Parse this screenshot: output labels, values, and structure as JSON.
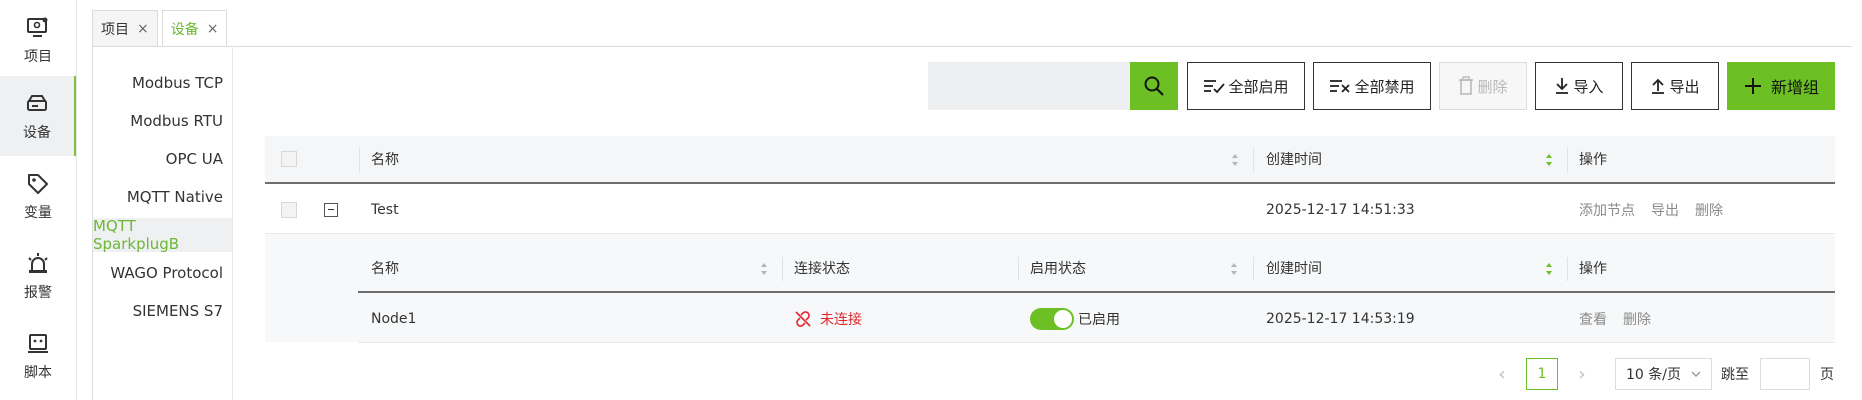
{
  "rail": [
    {
      "label": "项目",
      "icon": "monitor-settings-icon"
    },
    {
      "label": "设备",
      "icon": "router-icon",
      "active": true
    },
    {
      "label": "变量",
      "icon": "tag-icon"
    },
    {
      "label": "报警",
      "icon": "alarm-light-icon"
    },
    {
      "label": "脚本",
      "icon": "script-terminal-icon"
    }
  ],
  "tabs": [
    {
      "label": "项目",
      "close": "×"
    },
    {
      "label": "设备",
      "close": "×",
      "active": true
    }
  ],
  "protocols": [
    "Modbus TCP",
    "Modbus RTU",
    "OPC UA",
    "MQTT Native",
    "MQTT SparkplugB",
    "WAGO Protocol",
    "SIEMENS S7"
  ],
  "active_protocol": "MQTT SparkplugB",
  "toolbar": {
    "search_placeholder": "",
    "enable_all": "全部启用",
    "disable_all": "全部禁用",
    "delete": "删除",
    "import": "导入",
    "export": "导出",
    "add_group": "新增组"
  },
  "table": {
    "headers": {
      "name": "名称",
      "created": "创建时间",
      "ops": "操作"
    },
    "groups": [
      {
        "name": "Test",
        "created": "2025-12-17 14:51:33",
        "ops": [
          "添加节点",
          "导出",
          "删除"
        ],
        "expanded": true,
        "sub_headers": {
          "name": "名称",
          "conn": "连接状态",
          "enabled": "启用状态",
          "created": "创建时间",
          "ops": "操作"
        },
        "nodes": [
          {
            "name": "Node1",
            "conn": "未连接",
            "enabled": "已启用",
            "created": "2025-12-17 14:53:19",
            "ops": [
              "查看",
              "删除"
            ]
          }
        ]
      }
    ]
  },
  "pagination": {
    "prev": "‹",
    "current": "1",
    "next": "›",
    "page_size": "10 条/页",
    "jump_label": "跳至",
    "page_suffix": "页"
  },
  "colors": {
    "accent": "#6cc024",
    "danger": "#e0282e",
    "active_text": "#6cb834"
  }
}
